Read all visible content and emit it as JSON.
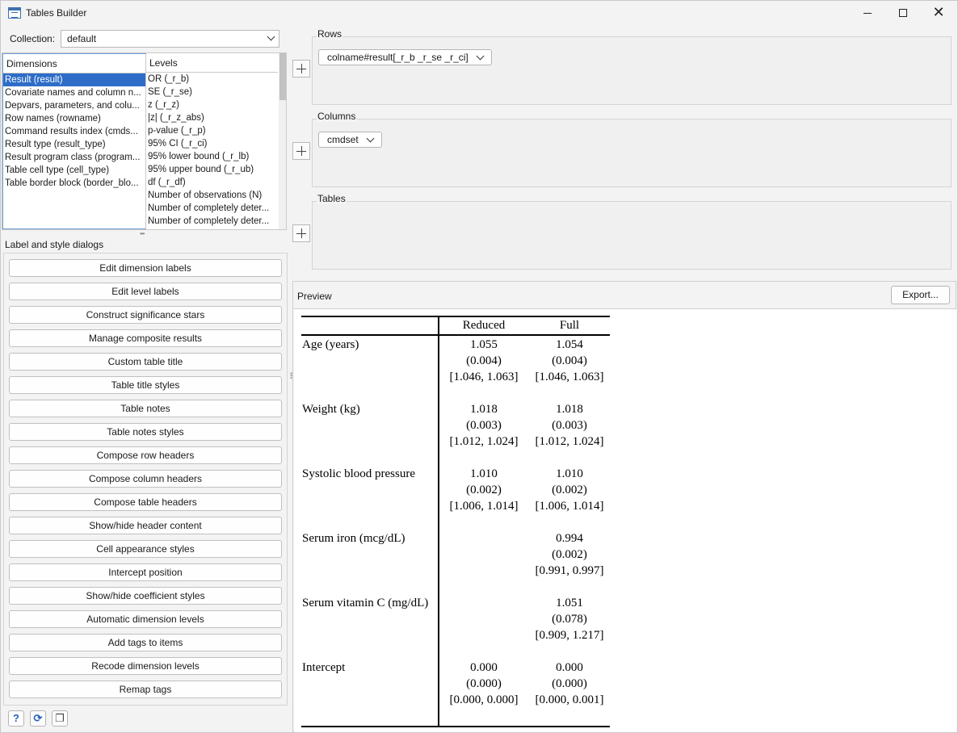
{
  "window": {
    "title": "Tables Builder"
  },
  "collection": {
    "label": "Collection:",
    "value": "default"
  },
  "dimensions": {
    "header": "Dimensions",
    "items": [
      "Result (result)",
      "Covariate names and column n...",
      "Depvars, parameters, and colu...",
      "Row names (rowname)",
      "Command results index (cmds...",
      "Result type (result_type)",
      "Result program class (program...",
      "Table cell type (cell_type)",
      "Table border block (border_blo..."
    ],
    "selected_index": 0
  },
  "levels": {
    "header": "Levels",
    "items": [
      "OR (_r_b)",
      "SE (_r_se)",
      "z (_r_z)",
      "|z| (_r_z_abs)",
      "p-value (_r_p)",
      "95% CI (_r_ci)",
      "95% lower bound (_r_lb)",
      "95% upper bound (_r_ub)",
      "df (_r_df)",
      "Number of observations (N)",
      "Number of completely deter...",
      "Number of completely deter..."
    ]
  },
  "label_style": {
    "title": "Label and style dialogs",
    "buttons": [
      "Edit dimension labels",
      "Edit level labels",
      "Construct significance stars",
      "Manage composite results",
      "Custom table title",
      "Table title styles",
      "Table notes",
      "Table notes styles",
      "Compose row headers",
      "Compose column headers",
      "Compose table headers",
      "Show/hide header content",
      "Cell appearance styles",
      "Intercept position",
      "Show/hide coefficient styles",
      "Automatic dimension levels",
      "Add tags to items",
      "Recode dimension levels",
      "Remap tags"
    ]
  },
  "footer_icons": [
    "help-icon",
    "refresh-icon",
    "copy-icon"
  ],
  "rows_group": {
    "label": "Rows",
    "pill": "colname#result[_r_b _r_se _r_ci]"
  },
  "columns_group": {
    "label": "Columns",
    "pill": "cmdset"
  },
  "tables_group": {
    "label": "Tables"
  },
  "preview": {
    "label": "Preview",
    "export_label": "Export...",
    "col_headers": [
      "Reduced",
      "Full"
    ],
    "rows": [
      {
        "name": "Age (years)",
        "reduced": [
          "1.055",
          "(0.004)",
          "[1.046, 1.063]"
        ],
        "full": [
          "1.054",
          "(0.004)",
          "[1.046, 1.063]"
        ]
      },
      {
        "name": "Weight (kg)",
        "reduced": [
          "1.018",
          "(0.003)",
          "[1.012, 1.024]"
        ],
        "full": [
          "1.018",
          "(0.003)",
          "[1.012, 1.024]"
        ]
      },
      {
        "name": "Systolic blood pressure",
        "reduced": [
          "1.010",
          "(0.002)",
          "[1.006, 1.014]"
        ],
        "full": [
          "1.010",
          "(0.002)",
          "[1.006, 1.014]"
        ]
      },
      {
        "name": "Serum iron (mcg/dL)",
        "reduced": [
          "",
          "",
          ""
        ],
        "full": [
          "0.994",
          "(0.002)",
          "[0.991, 0.997]"
        ]
      },
      {
        "name": "Serum vitamin C (mg/dL)",
        "reduced": [
          "",
          "",
          ""
        ],
        "full": [
          "1.051",
          "(0.078)",
          "[0.909, 1.217]"
        ]
      },
      {
        "name": "Intercept",
        "reduced": [
          "0.000",
          "(0.000)",
          "[0.000, 0.000]"
        ],
        "full": [
          "0.000",
          "(0.000)",
          "[0.000, 0.001]"
        ]
      }
    ]
  },
  "colors": {
    "selection": "#2d6dc8",
    "icon_blue": "#2563b8"
  }
}
